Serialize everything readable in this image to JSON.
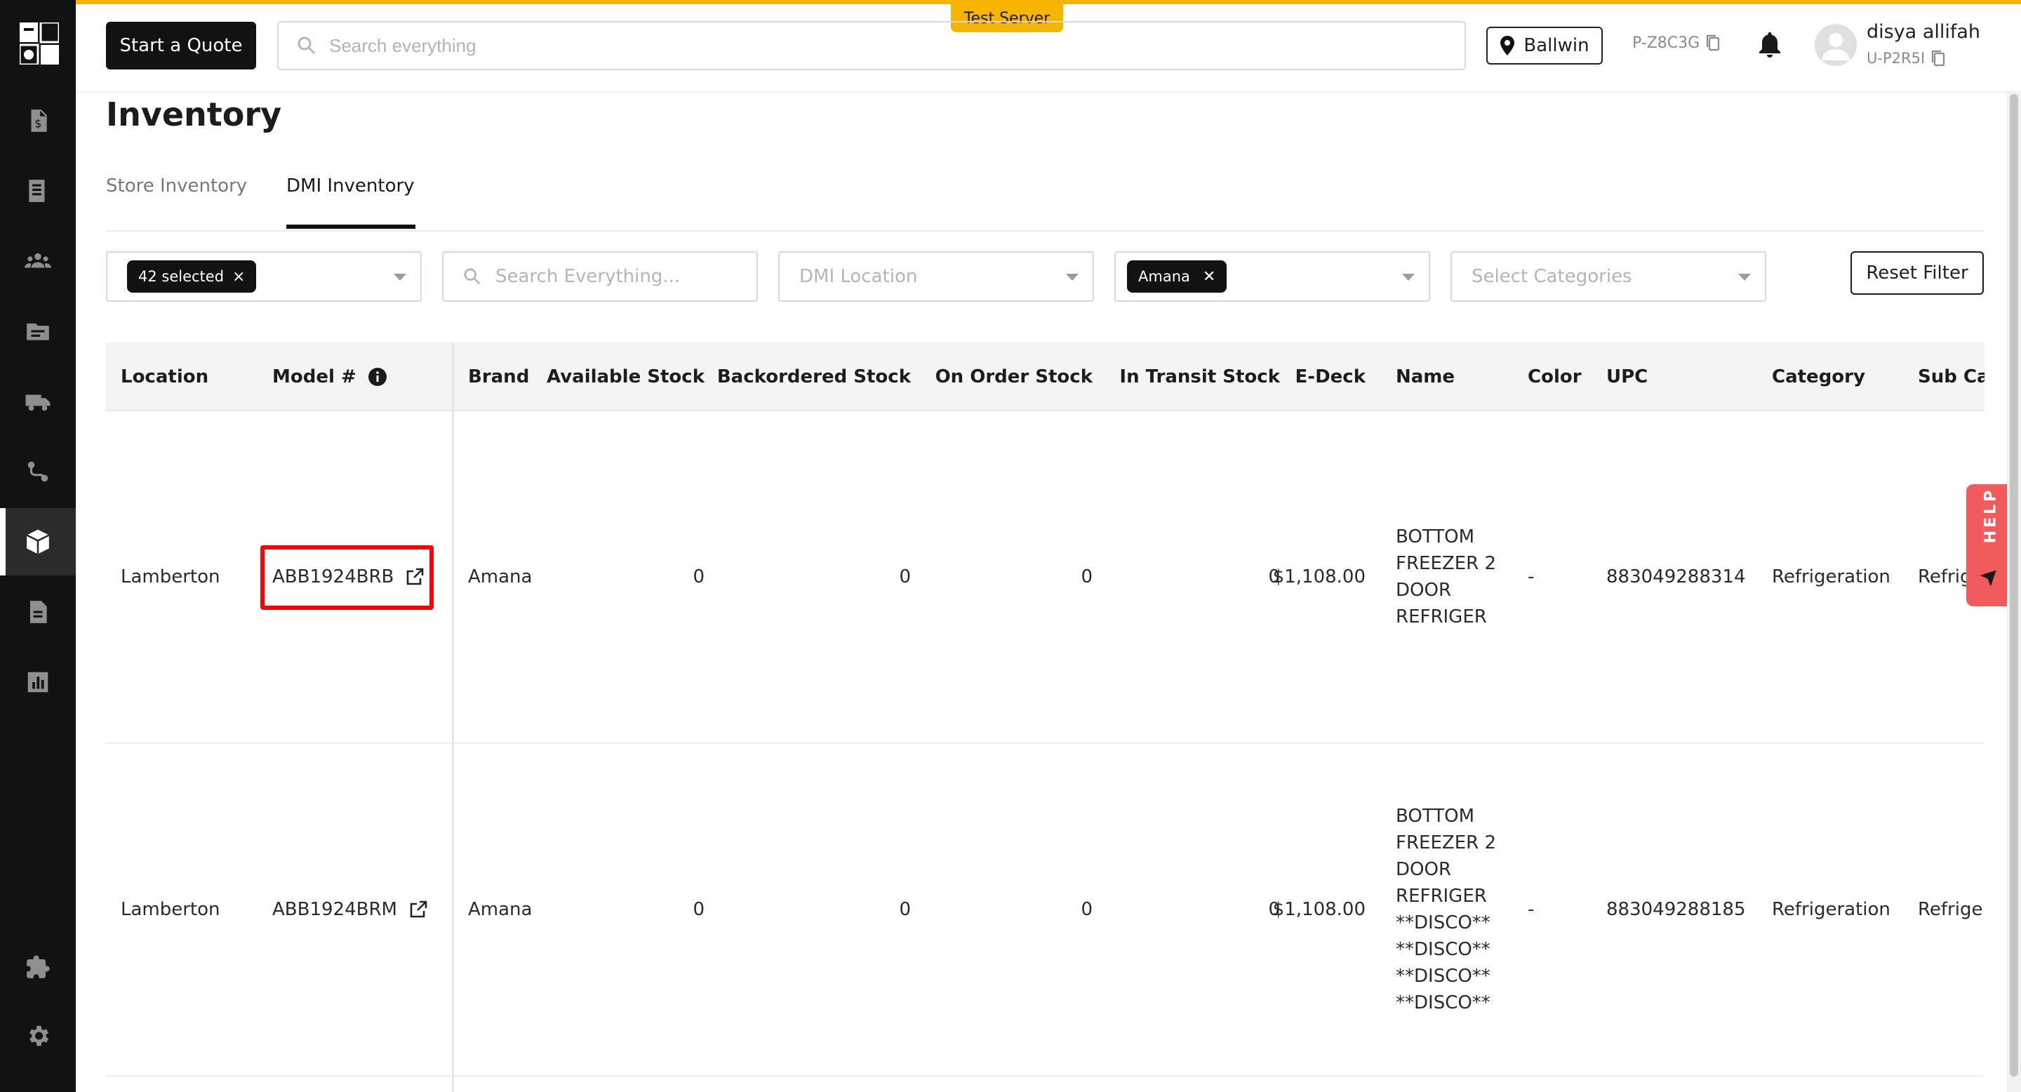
{
  "header": {
    "server_badge": "Test Server",
    "quote_button": "Start a Quote",
    "search_placeholder": "Search everything",
    "store": "Ballwin",
    "pcode": "P-Z8C3G",
    "user_name": "disya allifah",
    "user_code": "U-P2R5I"
  },
  "sidebar": {
    "items": [
      "quote-icon",
      "document-icon",
      "users-icon",
      "folder-icon",
      "truck-icon",
      "route-icon",
      "inventory-box-icon",
      "file-icon",
      "report-chart-icon",
      "puzzle-icon",
      "settings-gear-icon"
    ],
    "active": "inventory-box-icon"
  },
  "page": {
    "title": "Inventory",
    "tabs": [
      "Store Inventory",
      "DMI Inventory"
    ],
    "active_tab": "DMI Inventory"
  },
  "filters": {
    "stores_chip": "42 selected",
    "search_placeholder": "Search Everything...",
    "location_placeholder": "DMI Location",
    "brand_chip": "Amana",
    "categories_placeholder": "Select Categories",
    "reset_label": "Reset Filter",
    "chip_close": "×",
    "brand_close": "✕"
  },
  "table": {
    "columns": [
      "Location",
      "Model #",
      "Brand",
      "Available Stock",
      "Backordered Stock",
      "On Order Stock",
      "In Transit Stock",
      "E-Deck",
      "Name",
      "Color",
      "UPC",
      "Category",
      "Sub Ca"
    ],
    "rows": [
      {
        "location": "Lamberton",
        "model": "ABB1924BRB",
        "brand": "Amana",
        "available": "0",
        "backordered": "0",
        "on_order": "0",
        "in_transit": "0",
        "edeck": "$1,108.00",
        "name": "BOTTOM FREEZER 2 DOOR REFRIGER",
        "color": "-",
        "upc": "883049288314",
        "category": "Refrigeration",
        "subcategory": "Refrig"
      },
      {
        "location": "Lamberton",
        "model": "ABB1924BRM",
        "brand": "Amana",
        "available": "0",
        "backordered": "0",
        "on_order": "0",
        "in_transit": "0",
        "edeck": "$1,108.00",
        "name": "BOTTOM FREEZER 2 DOOR REFRIGER **DISCO** **DISCO** **DISCO** **DISCO**",
        "color": "-",
        "upc": "883049288185",
        "category": "Refrigeration",
        "subcategory": "Refrige"
      }
    ]
  },
  "help": {
    "label": "HELP"
  },
  "colors": {
    "accent": "#f7b500",
    "sidebar": "#121212",
    "highlight": "#ff0000",
    "help": "#f15b5b"
  }
}
